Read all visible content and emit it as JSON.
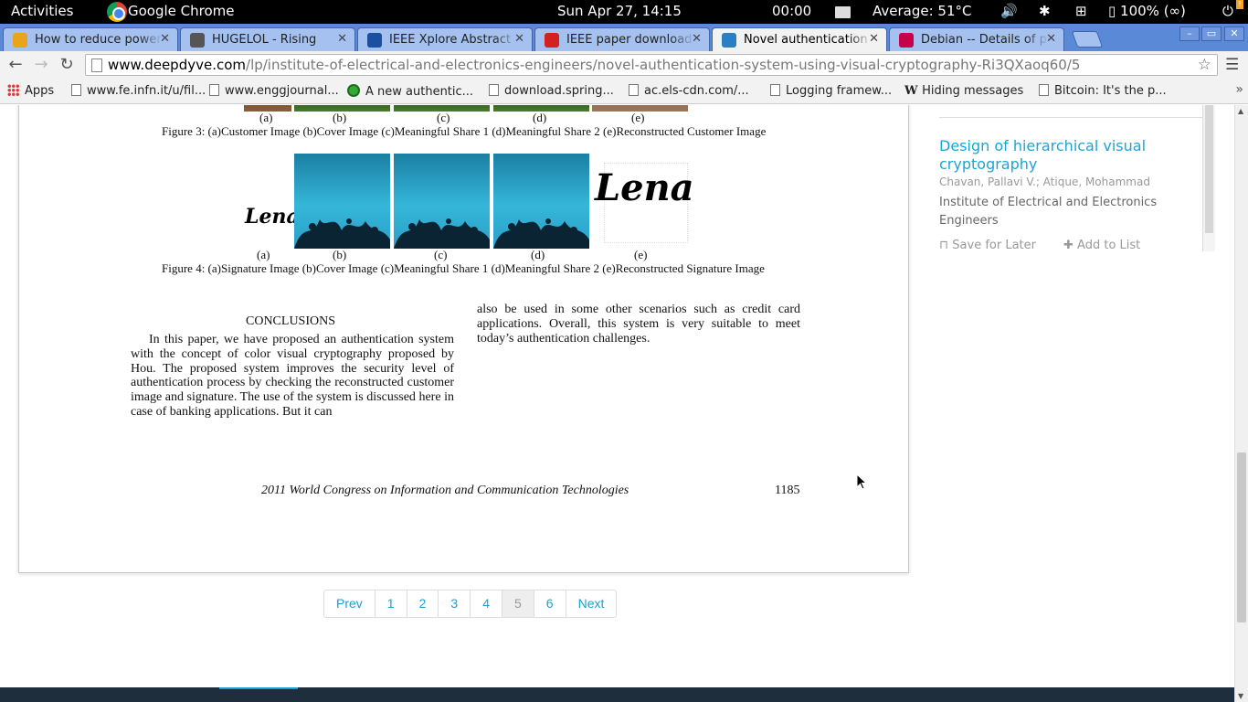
{
  "topbar": {
    "activities": "Activities",
    "app_name": "Google Chrome",
    "clock": "Sun Apr 27, 14:15",
    "timer": "00:00",
    "temperature": "Average: 51°C",
    "battery": "100% (∞)",
    "icons": [
      "folder-icon",
      "volume-icon",
      "bluetooth-icon",
      "network-icon",
      "battery-icon",
      "power-icon"
    ]
  },
  "tabs": [
    {
      "title": "How to reduce power c",
      "icon": "reddit-icon",
      "color": "#e8a41a"
    },
    {
      "title": "HUGELOL - Rising",
      "icon": "smiley-icon",
      "color": "#555555"
    },
    {
      "title": "IEEE Xplore Abstract -",
      "icon": "ieee-icon",
      "color": "#1b4fa0"
    },
    {
      "title": "IEEE paper download f",
      "icon": "youtube-icon",
      "color": "#d32020"
    },
    {
      "title": "Novel authentication s",
      "icon": "deepdyve-icon",
      "color": "#2a7fc4",
      "active": true
    },
    {
      "title": "Debian -- Details of pa",
      "icon": "debian-icon",
      "color": "#c7004c"
    }
  ],
  "toolbar": {
    "url_host": "www.deepdyve.com",
    "url_path": "/lp/institute-of-electrical-and-electronics-engineers/novel-authentication-system-using-visual-cryptography-Ri3QXaoq60/5"
  },
  "bookmarks": [
    {
      "label": "Apps",
      "icon": "apps-icon"
    },
    {
      "label": "www.fe.infn.it/u/fil...",
      "icon": "page-icon"
    },
    {
      "label": "www.enggjournal...",
      "icon": "page-icon"
    },
    {
      "label": "A new authentic...",
      "icon": "green-circle-icon"
    },
    {
      "label": "download.spring...",
      "icon": "page-icon"
    },
    {
      "label": "ac.els-cdn.com/...",
      "icon": "page-icon"
    },
    {
      "label": "Logging framew...",
      "icon": "page-icon"
    },
    {
      "label": "Hiding messages",
      "icon": "wikipedia-icon"
    },
    {
      "label": "Bitcoin: It's the p...",
      "icon": "page-icon"
    }
  ],
  "paper": {
    "sublabels": [
      "(a)",
      "(b)",
      "(c)",
      "(d)",
      "(e)"
    ],
    "fig3_caption": "Figure 3: (a)Customer Image (b)Cover Image (c)Meaningful Share 1 (d)Meaningful Share 2 (e)Reconstructed Customer Image",
    "fig4_caption": "Figure 4: (a)Signature Image (b)Cover Image (c)Meaningful Share 1 (d)Meaningful Share 2 (e)Reconstructed Signature Image",
    "signature_text": "Lena",
    "conclusions_title": "CONCLUSIONS",
    "conclusions_left": "In this paper, we have proposed an authentication system with the concept of color visual cryptography proposed by Hou. The proposed system improves the security level of authentication process by checking the reconstructed customer image and signature. The use of the system is discussed here in case of banking applications. But it can",
    "conclusions_right": "also be used in some other scenarios such as credit card applications. Overall, this system is very suitable to meet today’s authentication challenges.",
    "footer_venue": "2011 World Congress on Information and Communication Technologies",
    "footer_page": "1185"
  },
  "pagination": {
    "prev": "Prev",
    "pages": [
      "1",
      "2",
      "3",
      "4",
      "5",
      "6"
    ],
    "current": "5",
    "next": "Next"
  },
  "sidebar": {
    "title": "Design of hierarchical visual cryptography",
    "authors": "Chavan, Pallavi V.; Atique, Mohammad",
    "publisher": "Institute of Electrical and Electronics Engineers",
    "save_later": "Save for Later",
    "add_to_list": "Add to List",
    "notification": "!"
  },
  "colors": {
    "link": "#1aa5d6",
    "tab_strip": "#5a89d8",
    "footer_bar": "#1f2e3d"
  }
}
